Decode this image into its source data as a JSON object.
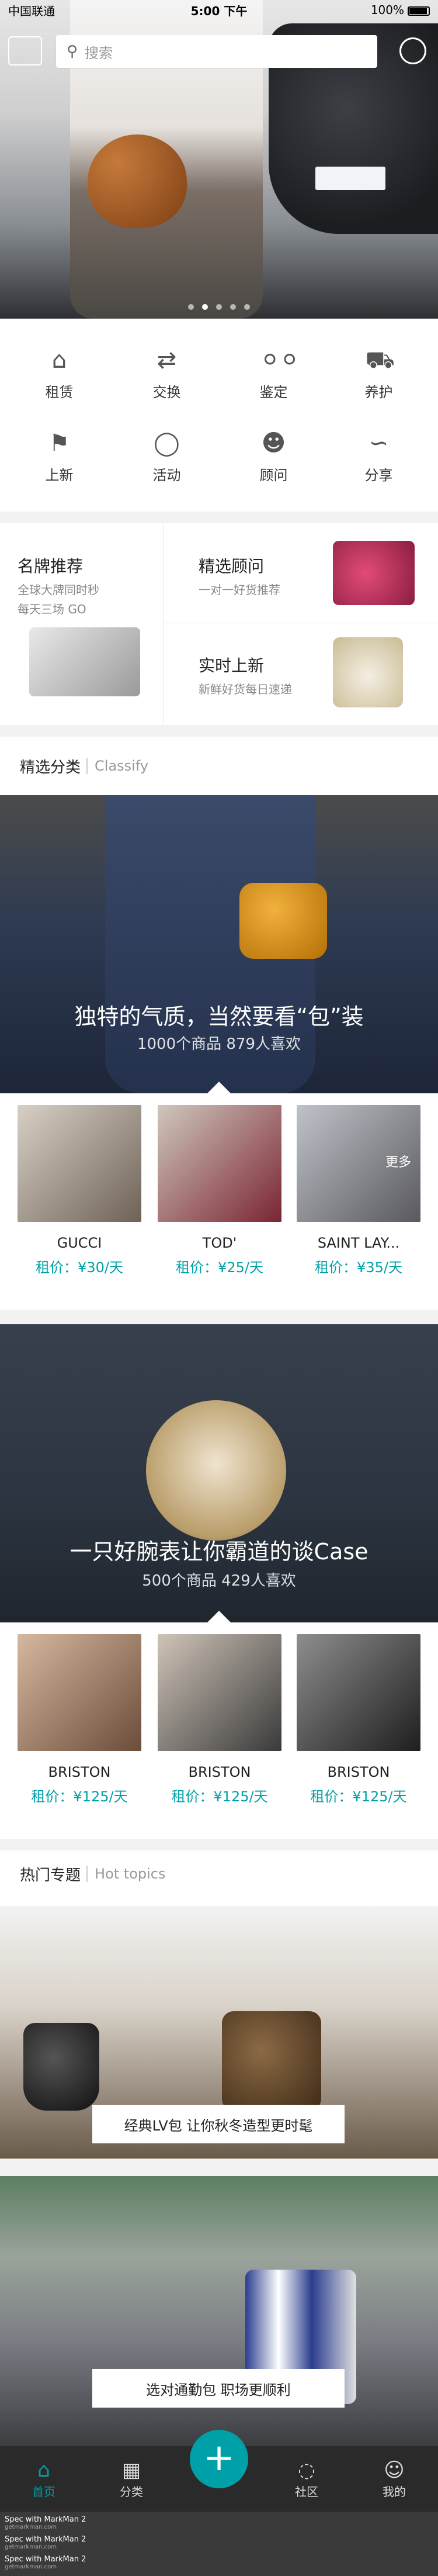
{
  "status": {
    "carrier": "中国联通",
    "time": "5:00 下午",
    "battery": "100%"
  },
  "search": {
    "placeholder": "搜索"
  },
  "banner_dots": 5,
  "grid": [
    {
      "label": "租赁",
      "icon": "house-icon"
    },
    {
      "label": "交换",
      "icon": "swap-icon"
    },
    {
      "label": "鉴定",
      "icon": "glasses-icon"
    },
    {
      "label": "养护",
      "icon": "bottle-icon"
    },
    {
      "label": "上新",
      "icon": "tag-icon"
    },
    {
      "label": "活动",
      "icon": "balloon-icon"
    },
    {
      "label": "顾问",
      "icon": "advisor-icon"
    },
    {
      "label": "分享",
      "icon": "share-icon"
    }
  ],
  "featured": {
    "brand": {
      "title": "名牌推荐",
      "sub1": "全球大牌同时秒",
      "sub2": "每天三场 GO"
    },
    "advisor": {
      "title": "精选顾问",
      "sub": "一对一好货推荐"
    },
    "new": {
      "title": "实时上新",
      "sub": "新鲜好货每日速递"
    }
  },
  "classify": {
    "zh": "精选分类",
    "en": "Classify"
  },
  "banner1": {
    "title": "独特的气质，当然要看“包”装",
    "stats": "1000个商品 879人喜欢"
  },
  "row1": {
    "more": "更多",
    "items": [
      {
        "name": "GUCCI",
        "price": "租价：¥30/天"
      },
      {
        "name": "TOD'",
        "price": "租价：¥25/天"
      },
      {
        "name": "SAINT LAY...",
        "price": "租价：¥35/天"
      }
    ]
  },
  "banner2": {
    "title": "一只好腕表让你霸道的谈Case",
    "stats": "500个商品 429人喜欢"
  },
  "row2": {
    "items": [
      {
        "name": "BRISTON",
        "price": "租价：¥125/天"
      },
      {
        "name": "BRISTON",
        "price": "租价：¥125/天"
      },
      {
        "name": "BRISTON",
        "price": "租价：¥125/天"
      }
    ]
  },
  "hot": {
    "zh": "热门专题",
    "en": "Hot topics"
  },
  "topics": [
    {
      "caption": "经典LV包 让你秋冬造型更时髦"
    },
    {
      "caption": "选对通勤包 职场更顺利"
    }
  ],
  "tabs": [
    {
      "label": "首页",
      "icon": "home-icon"
    },
    {
      "label": "分类",
      "icon": "grid-icon"
    },
    {
      "label": "发布",
      "icon": "plus-icon"
    },
    {
      "label": "社区",
      "icon": "chat-icon"
    },
    {
      "label": "我的",
      "icon": "user-icon"
    }
  ],
  "watermark": {
    "line1": "Spec with MarkMan 2",
    "line2": "getmarkman.com"
  },
  "colors": {
    "accent": "#00a0a8",
    "tabbar": "#2a2a2a",
    "separator": "#f2f2f2"
  }
}
